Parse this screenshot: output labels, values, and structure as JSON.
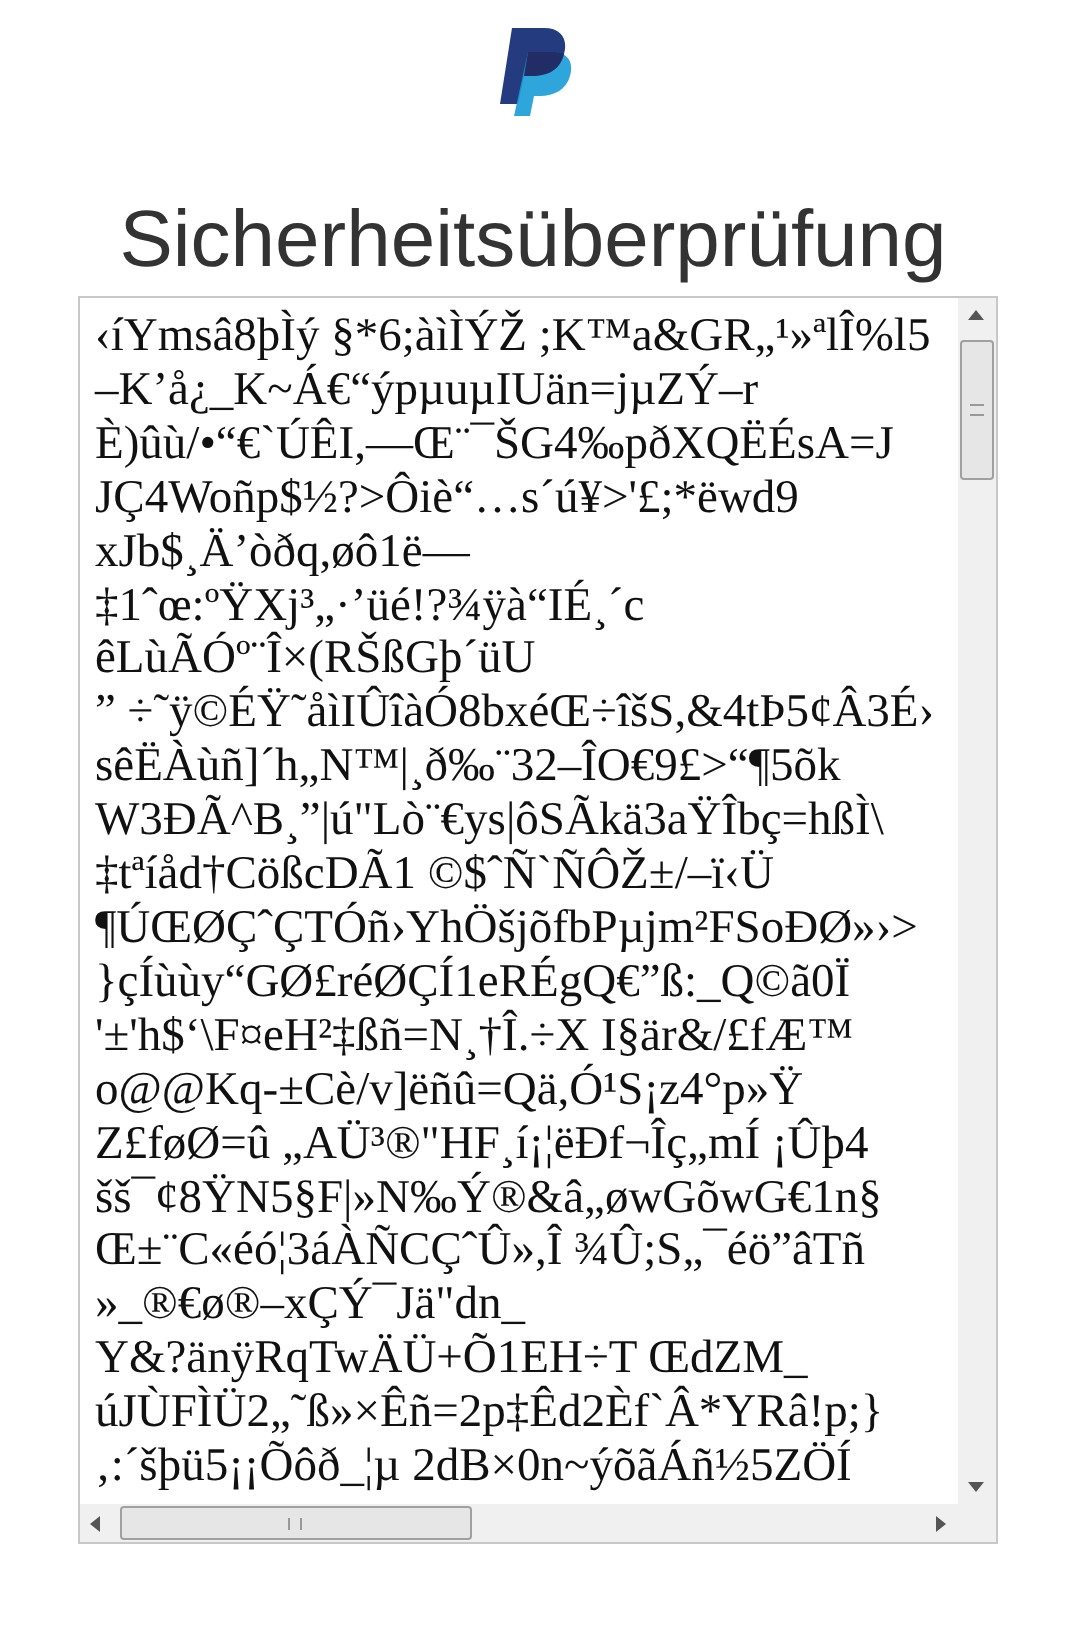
{
  "title": "Sicherheitsüberprüfung",
  "text_area": {
    "lines": [
      "‹íYmsâ8þÌý §*6;àìÌÝŽ ;K™a&GR„¹»ªlÎ%l5",
      "–K’å¿_K~Á€“ýpµuµIUän=jµZÝ–r",
      "È)ûù/•“€`ÚÊI,—Œ¨¯ŠG4‰pðXQËÉsA=J",
      "JÇ4Woñp$½?>Ôiè“…s´ú¥>'£;*ëwd9",
      "xJb$¸Ä’òðq,øô1ë—",
      "‡1ˆœ:ºŸXj³„·’üé!?¾ÿà“IÉ¸´c",
      "êLùÃÓº¨Î×(RŠßGþ´üU",
      "” ÷˜ÿ©ÉŸ˜åìIÛîàÓ8bxéŒ÷îšS,&4tÞ5¢Â3É›",
      "sêËÀùñ]´h„N™|¸ð‰¨32–ÎO€9£>“¶5õk",
      "W3ÐÃ^B¸”|ú\"Lò¨€ys|ôSÃkä3aŸÎbç=hßÌ\\",
      "‡tªíåd†CößcDÃ1 ©$ˆÑ`ÑÔŽ±/–ï‹Ü",
      "¶ÚŒØÇˆÇTÓñ›YhÖšjõfbPµjm²FSoÐØ»›>",
      "}çÍùùy“GØ£réØÇÍ1eRÉgQ€”ß:_Q©ã0Ï",
      "'±'h$‘\\F¤eH²‡ßñ=N¸†Î.÷X I§är&/£fÆ™",
      "o@@Kq-±Cè/v]ëñû=Qä,Ó¹S¡z4°p»Ÿ",
      "Z£føØ=û „AÜ³®\"HF¸í¡¦ëÐf¬Îç„mÍ ¡Ûþ4",
      "šš¯¢8ŸN5§F|»N‰Ý®&â„øwGõwG€1n§",
      "Œ±¨C«éó¦3áÀÑCÇˆÛ»,Î ¾Û;S„¯éö”âTñ",
      "»_®€ø®–xÇÝ¯Jä\"dn_",
      "Y&?änÿRqTwÄÜ+Õ1EH÷T ŒdZM_",
      "úJÙFÌÜ2„˜ß»×Êñ=2p‡Êd2Èf`Â*YRâ!p;}",
      "‚:´šþü5¡¡Õôð_¦µ 2dB×0n~ýõãÁñ½5ZÖÍ"
    ]
  }
}
